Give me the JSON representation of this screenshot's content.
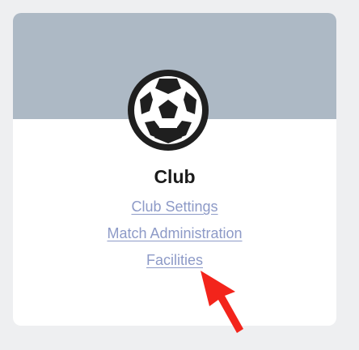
{
  "card": {
    "title": "Club",
    "icon": "soccer-ball-icon",
    "links": [
      {
        "label": "Club Settings"
      },
      {
        "label": "Match Administration"
      },
      {
        "label": "Facilities"
      }
    ]
  },
  "colors": {
    "page_background": "#eeeff1",
    "banner": "#adb9c5",
    "card_background": "#ffffff",
    "link": "#8d9ac7",
    "title": "#1b1b1b",
    "annotation_arrow": "#f3241b"
  },
  "annotation": {
    "icon": "red-arrow-icon",
    "points_to": "Facilities"
  }
}
